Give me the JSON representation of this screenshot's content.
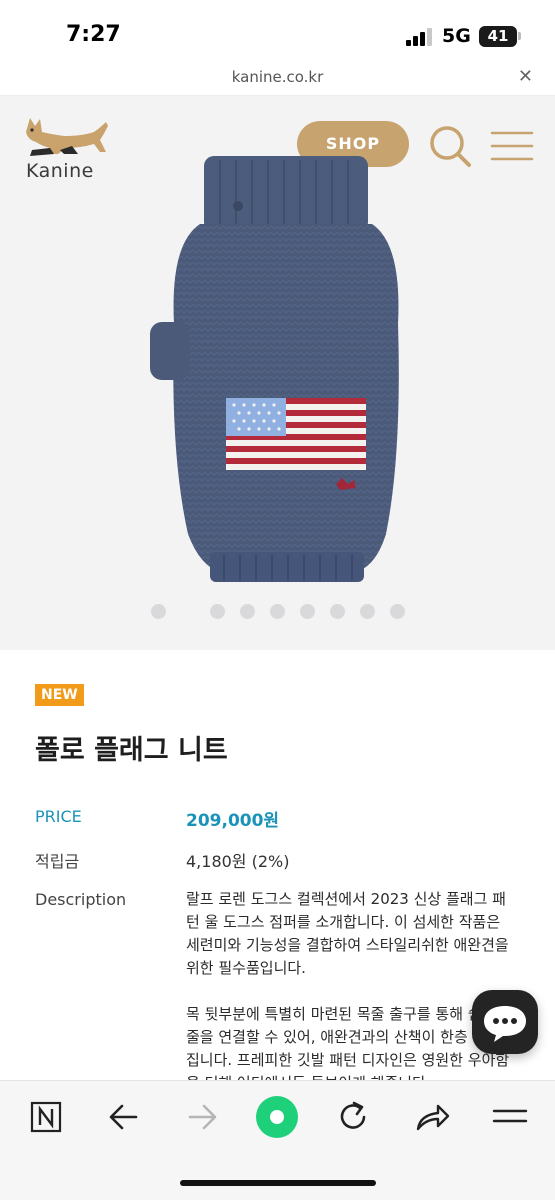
{
  "status_bar": {
    "time": "7:27",
    "network": "5G",
    "battery": "41"
  },
  "browser": {
    "url": "kanine.co.kr",
    "close_icon": "close-icon"
  },
  "header": {
    "brand": "Kanine",
    "shop_label": "SHOP",
    "search_icon": "search-icon",
    "menu_icon": "hamburger-menu-icon",
    "accent_color": "#c7a36f"
  },
  "gallery": {
    "image_count": 8,
    "active_index": 0
  },
  "product": {
    "badge": "NEW",
    "name": "폴로 플래그 니트",
    "price_label": "PRICE",
    "price": "209,000원",
    "points_label": "적립금",
    "points": "4,180원 (2%)",
    "description_label": "Description",
    "description": [
      "랄프 로렌 도그스 컬렉션에서 2023 신상 플래그 패턴 울 도그스 점퍼를 소개합니다. 이 섬세한 작품은 세련미와 기능성을 결합하여 스타일리쉬한 애완견을 위한 필수품입니다.",
      "목 뒷부분에 특별히 마련된 목줄 출구를 통해 쉽게 목줄을 연결할 수 있어, 애완견과의 산책이 한층 편리해집니다. 프레피한 깃발 패턴 디자인은 영원한 우아함을 더해 어디에서든 돋보이게 해줍니다."
    ],
    "price_color": "#1b93b8",
    "badge_color": "#f29a19"
  },
  "chat": {
    "icon": "chat-bubble-icon"
  },
  "toolbar": {
    "items": [
      "naver-n-icon",
      "back-arrow-icon",
      "forward-arrow-icon",
      "green-dot-icon",
      "reload-icon",
      "share-icon",
      "more-menu-icon"
    ]
  }
}
